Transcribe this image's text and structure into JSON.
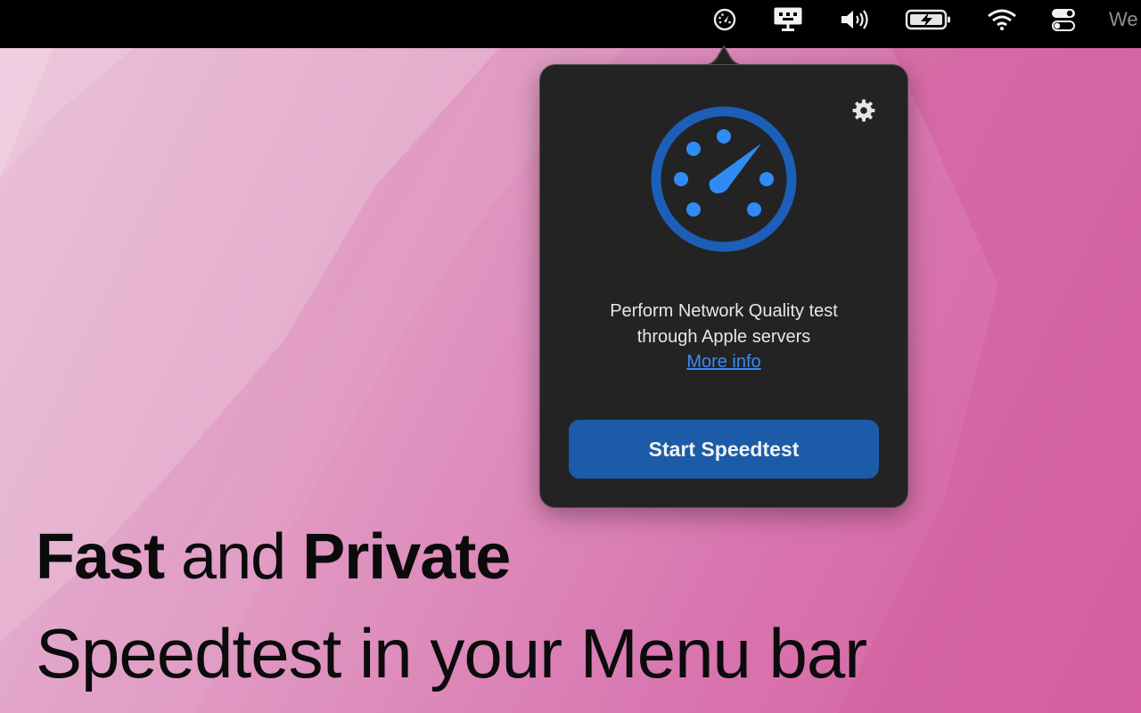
{
  "colors": {
    "menubar_bg": "#000000",
    "popover_bg": "#232324",
    "accent_blue": "#1b5ba8",
    "gauge_ring": "#1c5fb8",
    "gauge_dots": "#2f8cf5",
    "link_blue": "#3a8bf2",
    "wallpaper_pink": "#d768a6"
  },
  "menubar": {
    "icons": [
      {
        "name": "speedtest-gauge-icon"
      },
      {
        "name": "display-monitor-icon"
      },
      {
        "name": "volume-icon"
      },
      {
        "name": "battery-charging-icon"
      },
      {
        "name": "wifi-icon"
      },
      {
        "name": "control-center-icon"
      }
    ],
    "clock_partial": "We"
  },
  "popover": {
    "settings_icon": "gear-icon",
    "gauge_icon": "speedometer-icon",
    "description_line1": "Perform Network Quality test",
    "description_line2": "through Apple servers",
    "more_info_link": "More info",
    "start_button": "Start Speedtest"
  },
  "headline": {
    "line1_part1": "Fast",
    "line1_part2": " and ",
    "line1_part3": "Private",
    "line2": "Speedtest in your Menu bar"
  }
}
